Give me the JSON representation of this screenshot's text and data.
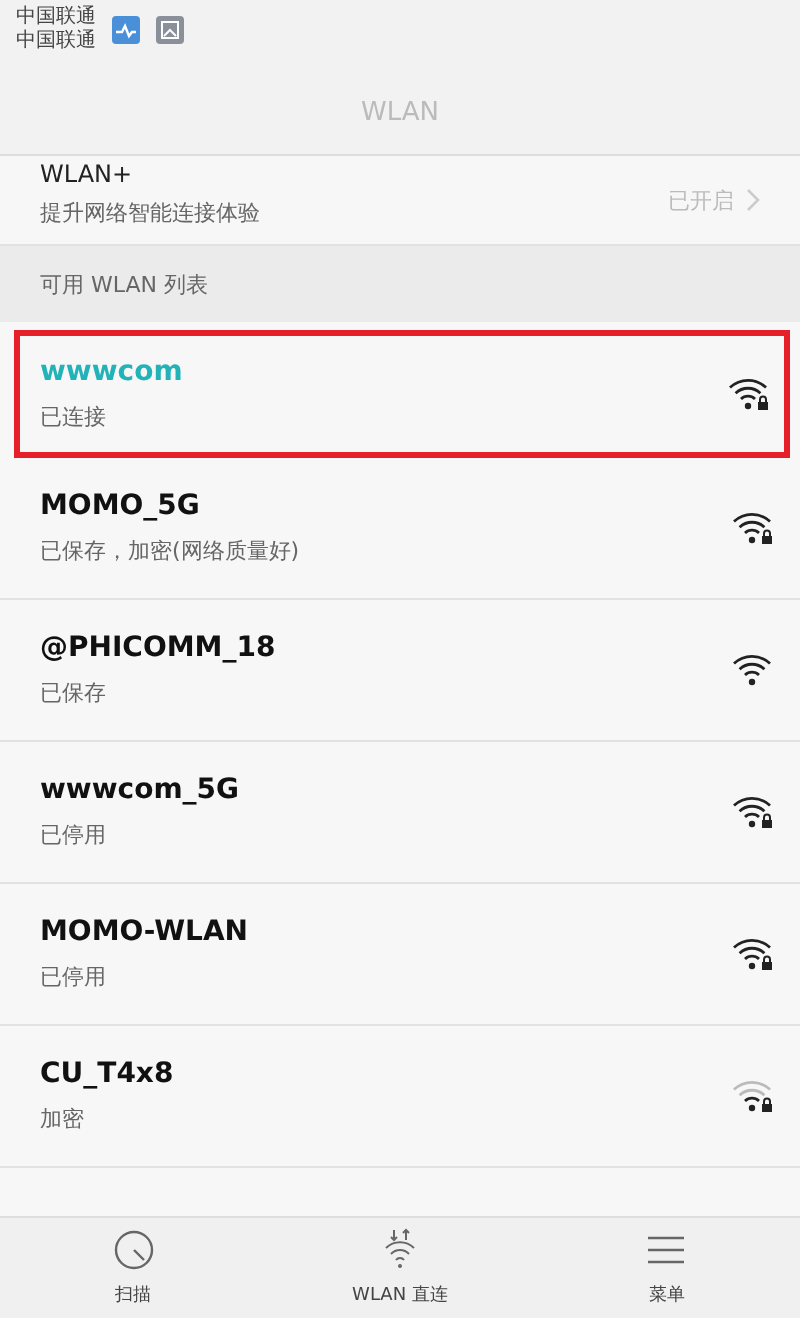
{
  "status_bar": {
    "carriers": [
      "中国联通",
      "中国联通"
    ]
  },
  "header": {
    "title": "WLAN"
  },
  "wlan_plus": {
    "title": "WLAN+",
    "subtitle": "提升网络智能连接体验",
    "value": "已开启"
  },
  "section_title": "可用 WLAN 列表",
  "networks": [
    {
      "name": "wwwcom",
      "status": "已连接",
      "connected": true,
      "highlighted": true,
      "locked": true,
      "kind": "strong"
    },
    {
      "name": "MOMO_5G",
      "status": "已保存，加密(网络质量好)",
      "connected": false,
      "highlighted": false,
      "locked": true,
      "kind": "strong"
    },
    {
      "name": "@PHICOMM_18",
      "status": "已保存",
      "connected": false,
      "highlighted": false,
      "locked": false,
      "kind": "strong"
    },
    {
      "name": "wwwcom_5G",
      "status": "已停用",
      "connected": false,
      "highlighted": false,
      "locked": true,
      "kind": "strong"
    },
    {
      "name": "MOMO-WLAN",
      "status": "已停用",
      "connected": false,
      "highlighted": false,
      "locked": true,
      "kind": "strong"
    },
    {
      "name": "CU_T4x8",
      "status": "加密",
      "connected": false,
      "highlighted": false,
      "locked": true,
      "kind": "weak"
    }
  ],
  "bottom_bar": [
    {
      "kind": "scan",
      "label": "扫描"
    },
    {
      "kind": "direct",
      "label": "WLAN 直连"
    },
    {
      "kind": "menu",
      "label": "菜单"
    }
  ]
}
